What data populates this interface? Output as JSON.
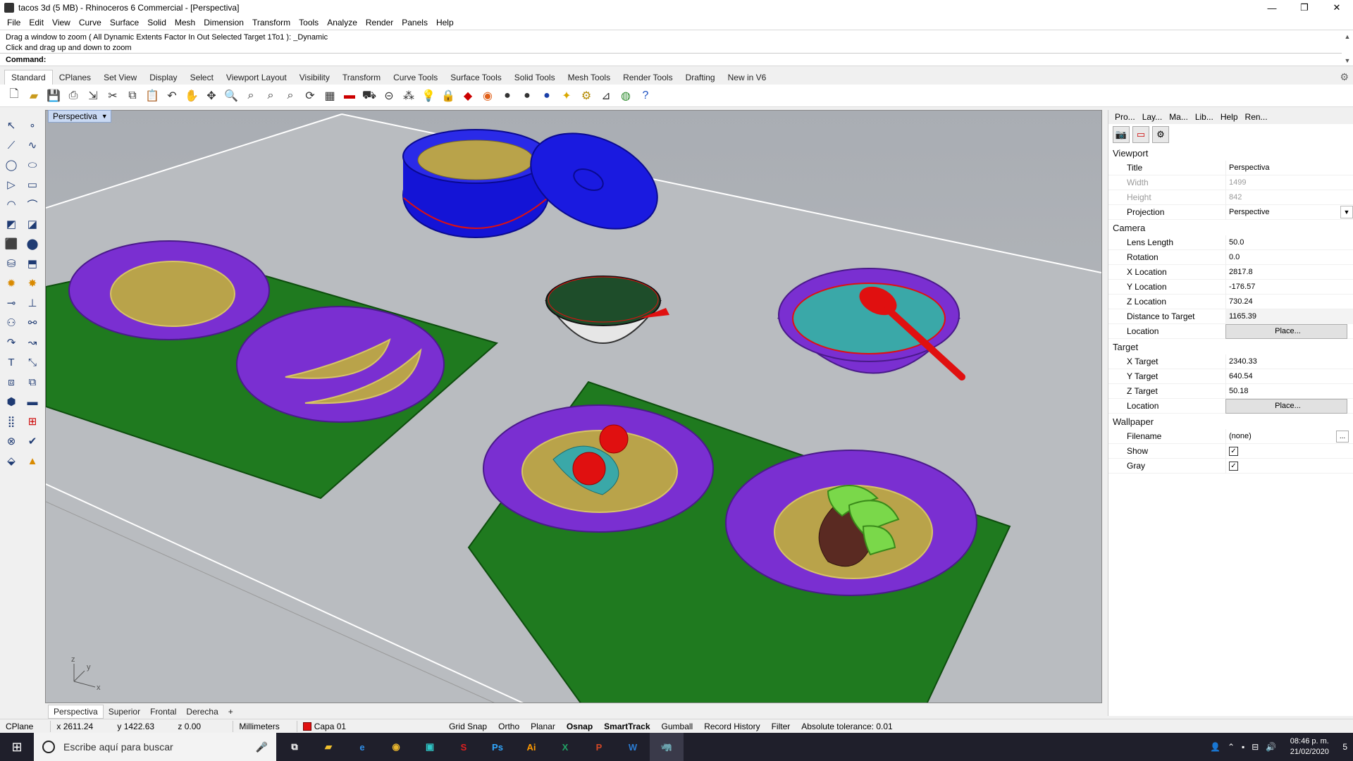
{
  "window": {
    "title": "tacos 3d (5 MB) - Rhinoceros 6 Commercial - [Perspectiva]",
    "minimize": "—",
    "maximize": "❐",
    "close": "✕"
  },
  "menu": [
    "File",
    "Edit",
    "View",
    "Curve",
    "Surface",
    "Solid",
    "Mesh",
    "Dimension",
    "Transform",
    "Tools",
    "Analyze",
    "Render",
    "Panels",
    "Help"
  ],
  "command": {
    "history_1": "Drag a window to zoom ( All  Dynamic  Extents  Factor  In  Out  Selected  Target  1To1 ): _Dynamic",
    "history_2": "Click and drag up and down to zoom",
    "prompt": "Command:",
    "value": ""
  },
  "toolbar_tabs": [
    "Standard",
    "CPlanes",
    "Set View",
    "Display",
    "Select",
    "Viewport Layout",
    "Visibility",
    "Transform",
    "Curve Tools",
    "Surface Tools",
    "Solid Tools",
    "Mesh Tools",
    "Render Tools",
    "Drafting",
    "New in V6"
  ],
  "viewport": {
    "label": "Perspectiva",
    "tabs": [
      "Perspectiva",
      "Superior",
      "Frontal",
      "Derecha"
    ],
    "add_tab": "+",
    "axis_x": "x",
    "axis_y": "y",
    "axis_z": "z"
  },
  "panel": {
    "tabs": [
      "Pro...",
      "Lay...",
      "Ma...",
      "Lib...",
      "Help",
      "Ren..."
    ],
    "viewport_section": "Viewport",
    "title_label": "Title",
    "title_value": "Perspectiva",
    "width_label": "Width",
    "width_value": "1499",
    "height_label": "Height",
    "height_value": "842",
    "projection_label": "Projection",
    "projection_value": "Perspective",
    "camera_section": "Camera",
    "lens_label": "Lens Length",
    "lens_value": "50.0",
    "rotation_label": "Rotation",
    "rotation_value": "0.0",
    "xloc_label": "X Location",
    "xloc_value": "2817.8",
    "yloc_label": "Y Location",
    "yloc_value": "-176.57",
    "zloc_label": "Z Location",
    "zloc_value": "730.24",
    "dist_label": "Distance to Target",
    "dist_value": "1165.39",
    "location_label": "Location",
    "place_button": "Place...",
    "target_section": "Target",
    "xt_label": "X Target",
    "xt_value": "2340.33",
    "yt_label": "Y Target",
    "yt_value": "640.54",
    "zt_label": "Z Target",
    "zt_value": "50.18",
    "tlocation_label": "Location",
    "wallpaper_section": "Wallpaper",
    "filename_label": "Filename",
    "filename_value": "(none)",
    "show_label": "Show",
    "gray_label": "Gray",
    "show_checked": true,
    "gray_checked": true
  },
  "status": {
    "cplane": "CPlane",
    "x": "x 2611.24",
    "y": "y 1422.63",
    "z": "z 0.00",
    "units": "Millimeters",
    "layer": "Capa 01",
    "grid_snap": "Grid Snap",
    "ortho": "Ortho",
    "planar": "Planar",
    "osnap": "Osnap",
    "smarttrack": "SmartTrack",
    "gumball": "Gumball",
    "record_history": "Record History",
    "filter": "Filter",
    "tolerance": "Absolute tolerance: 0.01"
  },
  "taskbar": {
    "search_placeholder": "Escribe aquí para buscar",
    "time": "08:46 p. m.",
    "date": "21/02/2020",
    "notifications": "5"
  },
  "colors": {
    "plate_purple": "#7a2fd1",
    "placemat_green": "#1f7a1f",
    "container_blue": "#1414d6",
    "tortilla": "#b9a34a",
    "accent_red": "#e01010"
  }
}
